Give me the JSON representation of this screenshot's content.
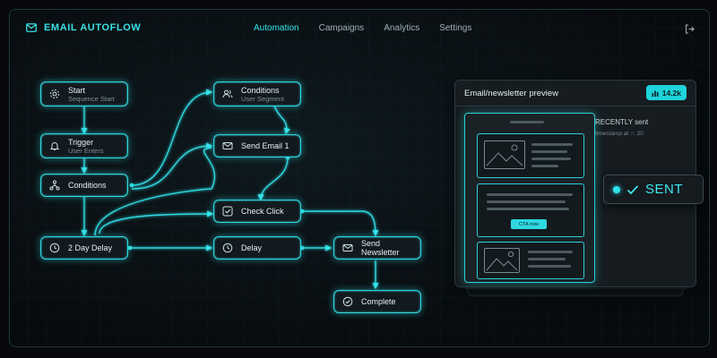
{
  "app": {
    "title": "EMAIL AUTOFLOW"
  },
  "nav": {
    "items": [
      {
        "label": "Automation",
        "active": true
      },
      {
        "label": "Campaigns",
        "active": false
      },
      {
        "label": "Analytics",
        "active": false
      },
      {
        "label": "Settings",
        "active": false
      }
    ]
  },
  "flow": {
    "nodes": {
      "start": {
        "title": "Start",
        "subtitle": "Sequence Start",
        "icon": "gear-icon"
      },
      "trigger": {
        "title": "Trigger",
        "subtitle": "User Enters",
        "icon": "bell-icon"
      },
      "conditions_left": {
        "title": "Conditions",
        "icon": "branch-icon"
      },
      "delay_2day": {
        "title": "2 Day Delay",
        "icon": "clock-icon"
      },
      "conditions_top": {
        "title": "Conditions",
        "subtitle": "User Segment",
        "icon": "users-icon"
      },
      "send_email_1": {
        "title": "Send Email 1",
        "icon": "mail-icon"
      },
      "check_click": {
        "title": "Check Click",
        "icon": "check-square-icon"
      },
      "delay": {
        "title": "Delay",
        "icon": "clock-icon"
      },
      "send_newsletter": {
        "title": "Send Newsletter",
        "icon": "mail-icon"
      },
      "complete": {
        "title": "Complete",
        "icon": "check-circle-icon"
      }
    }
  },
  "preview": {
    "title": "Email/newsletter preview",
    "count": "14.2k",
    "count_icon": "bar-chart-icon",
    "cta_label": "CTA now",
    "recent_label": "RECENTLY sent",
    "timestamp": "timestamp at ☆ 20"
  },
  "status": {
    "label": "SENT",
    "icon": "checkmark-icon"
  },
  "colors": {
    "accent": "#2fd8e0",
    "background": "#07090c",
    "node_bg": "#121a1f"
  }
}
